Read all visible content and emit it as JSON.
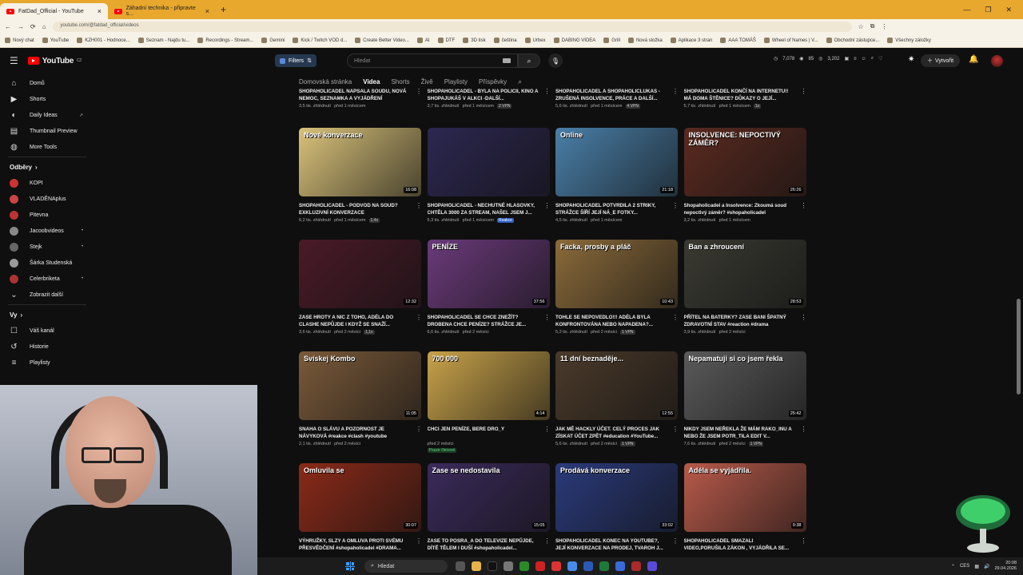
{
  "browser": {
    "tabs": [
      {
        "title": "FatDad_Official - YouTube",
        "active": true
      },
      {
        "title": "Záhadní technika - připravte s...",
        "active": false
      }
    ],
    "url": "youtube.com/@fatdad_official/videos",
    "bookmarks": [
      "Nový chat",
      "YouTube",
      "KZH001 - Hodnoce...",
      "Seznam - Najdu tu...",
      "Recordings - Stream...",
      "Gemini",
      "Kick / Twitch VOD d...",
      "Create Better Video...",
      "AI",
      "DTF",
      "3D tisk",
      "čeština",
      "Urbex",
      "DABING VIDEA",
      "Grill",
      "Nová složka",
      "Aplikace 3 stran",
      "AAA TOMÁŠ",
      "Wheel of Names | V...",
      "Obchodní zástupce...",
      "Všechny záložky"
    ]
  },
  "masthead": {
    "brand": "YouTube",
    "country": "CZ",
    "filters_label": "Filters",
    "search_placeholder": "Hledat",
    "stats": [
      "7,078",
      "85",
      "3,202"
    ],
    "create_label": "Vytvořit"
  },
  "sidebar": {
    "main": [
      {
        "label": "Domů",
        "icon": "home-icon"
      },
      {
        "label": "Shorts",
        "icon": "shorts-icon"
      },
      {
        "label": "Daily Ideas",
        "icon": "bulb-icon"
      },
      {
        "label": "Thumbnail Preview",
        "icon": "image-icon"
      },
      {
        "label": "More Tools",
        "icon": "tools-icon"
      }
    ],
    "subs_header": "Odběry",
    "subs": [
      {
        "label": "KOPI"
      },
      {
        "label": "VLADĚNAplus"
      },
      {
        "label": "Pitevna"
      },
      {
        "label": "Jacoobvideos"
      },
      {
        "label": "Stejk"
      },
      {
        "label": "Šárka Studenská"
      },
      {
        "label": "Celerbriketa"
      }
    ],
    "show_more": "Zobrazit další",
    "you_header": "Vy",
    "you": [
      {
        "label": "Váš kanál",
        "icon": "account-icon"
      },
      {
        "label": "Historie",
        "icon": "history-icon"
      },
      {
        "label": "Playlisty",
        "icon": "playlist-icon"
      }
    ]
  },
  "channel_tabs": [
    "Domovská stránka",
    "Videa",
    "Shorts",
    "Živě",
    "Playlisty",
    "Příspěvky"
  ],
  "active_tab": "Videa",
  "videos": [
    {
      "title": "SHOPAHOLICADEL NAPSALA SOUDU, NOVÁ NEMOC, SEZNAMKA A VYJÁDŘENÍ",
      "views": "3,5 tis. zhlédnutí",
      "age": "před 1 měsícem",
      "badge": "",
      "duration": "",
      "thumb": "#3a2a22",
      "thumb_text": ""
    },
    {
      "title": "SHOPAHOLICADEL - BYLA NA POLICII, KINO A SHOPAJUKÁŠ V ALKCI -DALŠÍ...",
      "views": "3,7 tis. zhlédnutí",
      "age": "před 1 měsícem",
      "badge": "2 VPN",
      "duration": "",
      "thumb": "#2a2a3a",
      "thumb_text": ""
    },
    {
      "title": "SHOPAHOLICADEL A SHOPAHOLICLUKAS - ZRUŠENÁ INSOLVENCE, PRÁCE A DALŠÍ...",
      "views": "5,6 tis. zhlédnutí",
      "age": "před 1 měsícem",
      "badge": "4 VPN",
      "duration": "",
      "thumb": "#3a3020",
      "thumb_text": ""
    },
    {
      "title": "SHOPAHOLICADEL KONČÍ NA INTERNETU!! MÁ DOMA ŠTĚNICE? DŮKAZY O JEJÍ...",
      "views": "5,7 tis. zhlédnutí",
      "age": "před 1 měsícem",
      "badge": "1x",
      "duration": "",
      "thumb": "#402222",
      "thumb_text": ""
    },
    {
      "title": "SHOPAHOLICADEL - PODVOD NA SOUD? EXKLUZIVNÍ KONVERZACE",
      "views": "6,2 tis. zhlédnutí",
      "age": "před 1 měsícem",
      "badge": "1,4x",
      "duration": "16:08",
      "thumb": "#d9c27a",
      "thumb_text": "Nové konverzace"
    },
    {
      "title": "SHOPAHOLICADEL - NECHUTNÉ HLASOVKY, CHTĚLA 3000 ZA STREAM, NAŠEL JSEM J...",
      "views": "5,3 tis. zhlédnutí",
      "age": "před 1 měsícem",
      "badge": "Reakce",
      "duration": "",
      "thumb": "#2c2750",
      "thumb_text": ""
    },
    {
      "title": "SHOPAHOLICADEL POTVRDILA 2 STRIKY, STRÁŽCE ŠÍŘÍ JEJÍ NÁ_E FOTKY...",
      "views": "4,5 tis. zhlédnutí",
      "age": "před 1 měsícem",
      "badge": "",
      "duration": "21:18",
      "thumb": "#4a7fa8",
      "thumb_text": "Online"
    },
    {
      "title": "Shopaholicadel a Insolvence: Zkoumá soud nepoctivý záměr? #shopaholicadel",
      "views": "3,2 tis. zhlédnutí",
      "age": "před 1 měsícem",
      "badge": "",
      "duration": "26:26",
      "thumb": "#5a2a20",
      "thumb_text": "INSOLVENCE: NEPOCTIVÝ ZÁMĚR?"
    },
    {
      "title": "ZASE HROTY A NIC Z TOHO, ADÉLA DO CLASHE NEPŮJDE I KDYŽ SE SNAŽÍ...",
      "views": "3,6 tis. zhlédnutí",
      "age": "před 2 měsíci",
      "badge": "1,1x",
      "duration": "12:32",
      "thumb": "#4a1a28",
      "thumb_text": ""
    },
    {
      "title": "SHOPAHOLICADEL SE CHCE ZNEŽÍT? DROBENA CHCE PENÍZE? STRÁŽCE JE...",
      "views": "6,6 tis. zhlédnutí",
      "age": "před 2 měsíci",
      "badge": "",
      "duration": "37:56",
      "thumb": "#6a3a7a",
      "thumb_text": "PENÍZE"
    },
    {
      "title": "TOHLE SE NEPOVEDLO!!! ADÉLA BYLA KONFRONTOVÁNA NEBO NAPADENA?...",
      "views": "5,2 tis. zhlédnutí",
      "age": "před 2 měsíci",
      "badge": "1 VPN",
      "duration": "10:43",
      "thumb": "#8a6a3a",
      "thumb_text": "Facka, prosby a pláč"
    },
    {
      "title": "PŘÍTEL NA BATERKY? ZASE BANI ŠPATNÝ ZDRAVOTNÍ STAV #reaction #drama",
      "views": "3,9 tis. zhlédnutí",
      "age": "před 2 měsíci",
      "badge": "",
      "duration": "28:53",
      "thumb": "#3a3a32",
      "thumb_text": "Ban a zhroucení"
    },
    {
      "title": "SNAHA O SLÁVU A POZORNOST JE NÁVYKOVÁ #reakce #clash #youtube",
      "views": "2,1 tis. zhlédnutí",
      "age": "před 2 měsíci",
      "badge": "",
      "duration": "11:05",
      "thumb": "#7a5a3a",
      "thumb_text": "Svískej Kombo"
    },
    {
      "title": "CHCI JEN PENÍZE, BERE DRO_Y",
      "views": "",
      "age": "před 2 měsíci",
      "badge": "Pouze členové",
      "duration": "4:14",
      "thumb": "#c8a24a",
      "thumb_text": "700 000"
    },
    {
      "title": "JAK MĚ HACKLY ÚČET. CELÝ PROCES JAK ZÍSKAT ÚČET ZPĚT #education #YouTube...",
      "views": "5,6 tis. zhlédnutí",
      "age": "před 2 měsíci",
      "badge": "1 VPN",
      "duration": "12:55",
      "thumb": "#4a3a2a",
      "thumb_text": "11 dní beznaděje..."
    },
    {
      "title": "NIKDY JSEM NEŘEKLA ŽE MÁM RAKO_INU A NEBO ŽE JSEM POTR_TILA EDIT V...",
      "views": "7,6 tis. zhlédnutí",
      "age": "před 2 měsíci",
      "badge": "1 VPN",
      "duration": "25:42",
      "thumb": "#5a5a5a",
      "thumb_text": "Nepamatuji si co jsem řekla"
    },
    {
      "title": "VÝHRUŽKY, SLZY A OMLUVA PROTI SVÉMU PŘESVĚDČENÍ #shopaholicadel #DRAMA...",
      "views": "",
      "age": "",
      "badge": "",
      "duration": "30:07",
      "thumb": "#8a2a18",
      "thumb_text": "Omluvila se"
    },
    {
      "title": "ZASE TO POSRA_A DO TELEVIZE NEPŮJDE, DÍTĚ TĚLEM I DUŠÍ #shopaholicadel...",
      "views": "",
      "age": "",
      "badge": "",
      "duration": "15:05",
      "thumb": "#3a2a5a",
      "thumb_text": "Zase se nedostavila"
    },
    {
      "title": "SHOPAHOLICADEL KONEC NA YOUTUBE?, JEJÍ KONVERZACE NA PRODEJ, TVAROH J...",
      "views": "",
      "age": "",
      "badge": "",
      "duration": "33:02",
      "thumb": "#2a3a7a",
      "thumb_text": "Prodává konverzace"
    },
    {
      "title": "SHOPAHOLICADEL SMAZALI VIDEO,PORUŠILA ZÁKON , VYJÁDŘILA SE...",
      "views": "",
      "age": "",
      "badge": "",
      "duration": "9:38",
      "thumb": "#b85a4a",
      "thumb_text": "Adéla se vyjádřila."
    }
  ],
  "taskbar": {
    "search": "Hledat",
    "lang": "CES",
    "time": "20:08",
    "date": "29.04.2026"
  }
}
